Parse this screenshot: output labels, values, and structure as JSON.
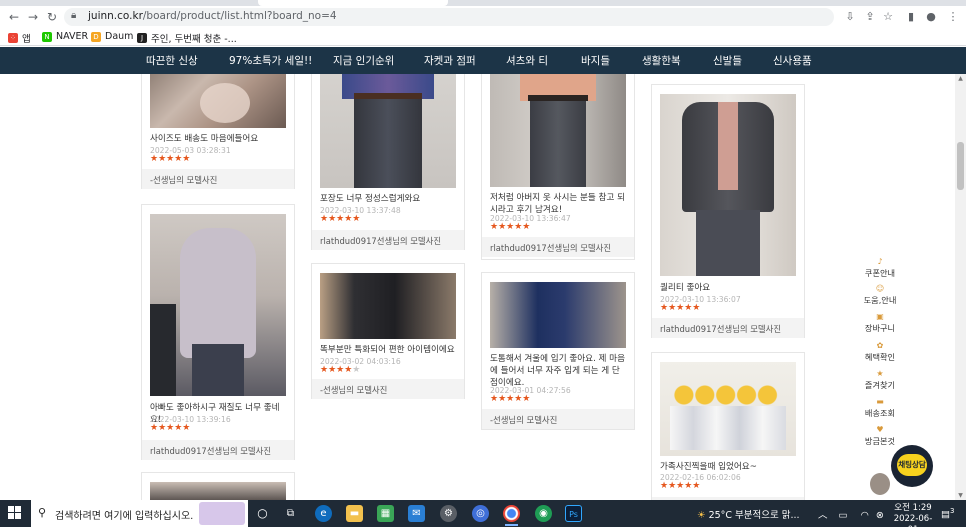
{
  "browser": {
    "url_main": "juinn.co.kr",
    "url_rest": "/board/product/list.html?board_no=4",
    "bookmarks": [
      {
        "label": "앱",
        "color": "#e8453c",
        "glyph": "⋮⋮"
      },
      {
        "label": "NAVER",
        "color": "#1ec800",
        "glyph": "N"
      },
      {
        "label": "Daum",
        "color": "#f5a623",
        "glyph": "D"
      },
      {
        "label": "주인, 두번째 청춘 -...",
        "color": "#222222",
        "glyph": "J"
      }
    ]
  },
  "site_nav": {
    "items": [
      "따끈한 신상",
      "97%초특가 세일!!",
      "지금 인기순위",
      "자켓과 점퍼",
      "셔츠와 티",
      "바지들",
      "생활한복",
      "신발들",
      "신사용품"
    ]
  },
  "reviews": [
    {
      "text": "사이즈도 배송도 마음에들어요",
      "date": "2022-05-03 03:28:31",
      "rating": 5,
      "footer": "-선생님의 모델사진"
    },
    {
      "text": "아빠도 좋아하시구 재질도 너무 좋네요!",
      "date": "2022-03-10 13:39:16",
      "rating": 5,
      "footer": "rlathdud0917선생님의 모델사진"
    },
    {
      "text": "포장도 너무 정성스럽게와요",
      "date": "2022-03-10 13:37:48",
      "rating": 5,
      "footer": "rlathdud0917선생님의 모델사진"
    },
    {
      "text": "똑부분만 특화되어 편한 아이템이에요",
      "date": "2022-03-02 04:03:16",
      "rating": 4,
      "footer": "-선생님의 모델사진"
    },
    {
      "text": "저처럼 아버지 옷 사시는 분들 참고 되시라고 후기 남겨요!",
      "date": "2022-03-10 13:36:47",
      "rating": 5,
      "footer": "rlathdud0917선생님의 모델사진"
    },
    {
      "text": "도톰해서 겨울에 입기 좋아요. 제 마음에 들어서 너무 자주 입게 되는 게 단점이에요.",
      "date": "2022-03-01 04:27:56",
      "rating": 5,
      "footer": "-선생님의 모델사진"
    },
    {
      "text": "퀄리티 좋아요",
      "date": "2022-03-10 13:36:07",
      "rating": 5,
      "footer": "rlathdud0917선생님의 모델사진"
    },
    {
      "text": "가족사진찍을때 입었어요~",
      "date": "2022-02-16 06:02:06",
      "rating": 5,
      "footer": "rlathdud0917선생님의 모델사진"
    }
  ],
  "quick_menu": [
    {
      "label": "쿠폰안내",
      "icon": "bell-icon",
      "glyph": "♪"
    },
    {
      "label": "도움,안내",
      "icon": "help-icon",
      "glyph": "☺"
    },
    {
      "label": "장바구니",
      "icon": "cart-icon",
      "glyph": "▣"
    },
    {
      "label": "혜택확인",
      "icon": "gift-icon",
      "glyph": "✿"
    },
    {
      "label": "즐겨찾기",
      "icon": "star-icon",
      "glyph": "★"
    },
    {
      "label": "배송조회",
      "icon": "truck-icon",
      "glyph": "▬"
    },
    {
      "label": "방금본것",
      "icon": "heart-icon",
      "glyph": "♥"
    }
  ],
  "chat_button": "채팅상담",
  "taskbar": {
    "search_placeholder": "검색하려면 여기에 입력하십시오.",
    "weather": "25°C 부분적으로 맑...",
    "time": "오전 1:29",
    "date": "2022-06-01",
    "notification_count": "3"
  },
  "colors": {
    "site_nav_bg": "#1c3447",
    "star": "#e5571e",
    "taskbar_bg": "#1f2a36"
  }
}
